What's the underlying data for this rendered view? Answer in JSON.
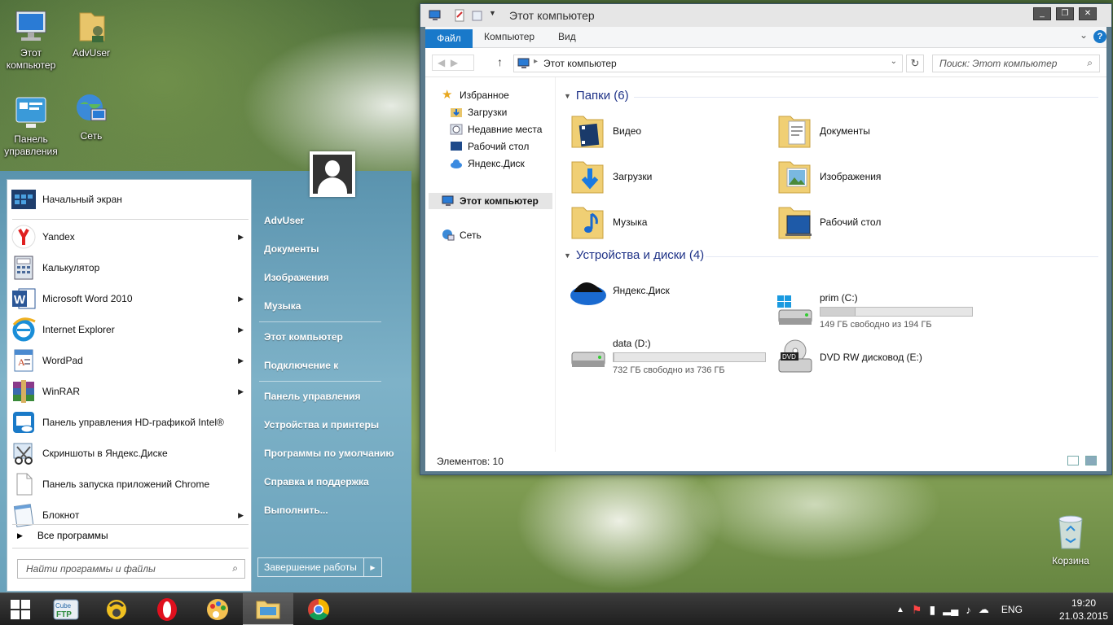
{
  "desktop": {
    "icons": [
      {
        "label_line1": "Этот",
        "label_line2": "компьютер"
      },
      {
        "label_line1": "AdvUser",
        "label_line2": ""
      },
      {
        "label_line1": "Панель",
        "label_line2": "управления"
      },
      {
        "label_line1": "Сеть",
        "label_line2": ""
      }
    ],
    "recycle_bin": "Корзина"
  },
  "start_menu": {
    "pinned": [
      {
        "label": "Начальный экран",
        "icon": "start-screen-icon",
        "has_arrow": false
      },
      {
        "label": "Yandex",
        "icon": "yandex-browser-icon",
        "has_arrow": true
      },
      {
        "label": "Калькулятор",
        "icon": "calculator-icon",
        "has_arrow": false
      },
      {
        "label": "Microsoft Word 2010",
        "icon": "word-icon",
        "has_arrow": true
      },
      {
        "label": "Internet Explorer",
        "icon": "ie-icon",
        "has_arrow": true
      },
      {
        "label": "WordPad",
        "icon": "wordpad-icon",
        "has_arrow": true
      },
      {
        "label": "WinRAR",
        "icon": "winrar-icon",
        "has_arrow": true
      },
      {
        "label": "Панель управления HD-графикой Intel®",
        "icon": "intel-graphics-icon",
        "has_arrow": false
      },
      {
        "label": "Скриншоты в Яндекс.Диске",
        "icon": "scissors-icon",
        "has_arrow": false
      },
      {
        "label": "Панель запуска приложений Chrome",
        "icon": "document-icon",
        "has_arrow": false
      },
      {
        "label": "Блокнот",
        "icon": "notepad-icon",
        "has_arrow": true
      }
    ],
    "all_programs": "Все программы",
    "search_placeholder": "Найти программы и файлы",
    "right_items": [
      "AdvUser",
      "Документы",
      "Изображения",
      "Музыка",
      "Этот компьютер",
      "Подключение к",
      "Панель управления",
      "Устройства и принтеры",
      "Программы по умолчанию",
      "Справка и поддержка",
      "Выполнить..."
    ],
    "shutdown": "Завершение работы"
  },
  "explorer": {
    "title": "Этот компьютер",
    "tabs": {
      "file": "Файл",
      "computer": "Компьютер",
      "view": "Вид"
    },
    "address": "Этот компьютер",
    "search_placeholder": "Поиск: Этот компьютер",
    "nav": {
      "favorites": "Избранное",
      "downloads": "Загрузки",
      "recent": "Недавние места",
      "desktop": "Рабочий стол",
      "yadisk": "Яндекс.Диск",
      "this_pc": "Этот компьютер",
      "network": "Сеть"
    },
    "folders_header": "Папки (6)",
    "folders": [
      "Видео",
      "Документы",
      "Загрузки",
      "Изображения",
      "Музыка",
      "Рабочий стол"
    ],
    "devices_header": "Устройства и диски (4)",
    "devices": [
      {
        "name": "Яндекс.Диск",
        "free": "",
        "used_fraction": null
      },
      {
        "name": "prim (C:)",
        "free": "149 ГБ свободно из 194 ГБ",
        "used_fraction": 0.23
      },
      {
        "name": "data (D:)",
        "free": "732 ГБ свободно из 736 ГБ",
        "used_fraction": 0.005
      },
      {
        "name": "DVD RW дисковод (E:)",
        "free": "",
        "used_fraction": null
      }
    ],
    "status": "Элементов: 10"
  },
  "taskbar": {
    "apps": [
      "cubeftp-icon",
      "messenger-icon",
      "opera-icon",
      "paint-icon",
      "explorer-icon",
      "chrome-icon"
    ],
    "lang": "ENG",
    "time": "19:20",
    "date": "21.03.2015"
  },
  "colors": {
    "accent": "#1979ca",
    "start_menu_bg": "#6aa2bb",
    "group_header": "#1e3287"
  }
}
